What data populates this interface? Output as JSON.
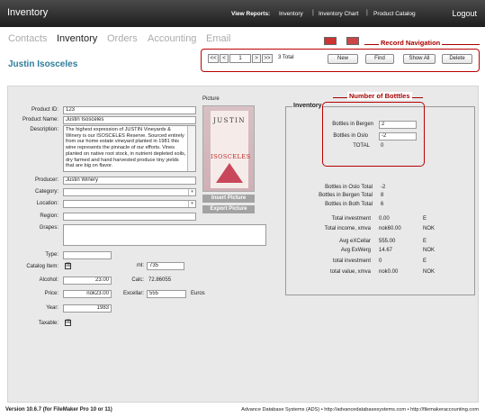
{
  "app": {
    "title": "Inventory",
    "logout": "Logout"
  },
  "reports": {
    "label": "View Reports:",
    "links": [
      "Inventory",
      "Inventory Chart",
      "Product Catalog"
    ]
  },
  "tabs": [
    "Contacts",
    "Inventory",
    "Orders",
    "Accounting",
    "Email"
  ],
  "annotations": {
    "record_navigation": "Record Navigation",
    "number_of_bottles": "Number of Botttles"
  },
  "nav": {
    "first": "<<",
    "prev": "<",
    "record": "1",
    "next": ">",
    "last": ">>",
    "total": "3  Total",
    "new": "New",
    "find": "Find",
    "show_all": "Show All",
    "delete": "Delete"
  },
  "record_name": "Justin Isosceles",
  "form": {
    "product_id_label": "Product ID:",
    "product_id": "123",
    "product_name_label": "Product Name:",
    "product_name": "Justin Isosceles",
    "description_label": "Description:",
    "description": "The highest expression of JUSTIN Vineyards & Winery is our ISOSCELES Reserve. Sourced entirely from our home estate vineyard planted in 1981 this wine represents the pinnacle of our efforts. Vines planted on native root stock, in nutrient depleted soils, dry farmed and hand harvested produce tiny yields that are big on flavor.",
    "producer_label": "Producer:",
    "producer": "Justin Winery",
    "category_label": "Category:",
    "location_label": "Location:",
    "region_label": "Region:",
    "grapes_label": "Grapes:",
    "type_label": "Type:",
    "catalog_item_label": "Catalog Item:",
    "alcohol_label": "Alcohol:",
    "alcohol": "23.00",
    "price_label": "Price:",
    "price": "nok23.00",
    "year_label": "Year:",
    "year": "1983",
    "taxable_label": "Taxable:",
    "ml_label": "ml:",
    "ml": "735",
    "calc_label": "Calc:",
    "calc": "72.86055",
    "excellar_label": "Excellar:",
    "excellar": "555",
    "euros": "Euros"
  },
  "picture": {
    "label": "Picture",
    "insert": "Insert Picture",
    "export": "Export Picture",
    "label_top": "JUSTIN",
    "label_mid": "ISOSCELES"
  },
  "inventory": {
    "title": "Inventory",
    "bergen_label": "Bottles in Bergen",
    "bergen": "2",
    "oslo_label": "Bottles in Oslo",
    "oslo": "-2",
    "total_label": "TOTAL",
    "total": "0",
    "rows": [
      {
        "label": "Bottles in Oslo Total",
        "value": "-2",
        "unit": ""
      },
      {
        "label": "Bottles in Bergen Total",
        "value": "8",
        "unit": ""
      },
      {
        "label": "Bottles in Both Total",
        "value": "6",
        "unit": ""
      },
      {
        "label": "Total investment",
        "value": "0.00",
        "unit": "E"
      },
      {
        "label": "Total income, xmva",
        "value": "nok60.00",
        "unit": "NOK"
      },
      {
        "label": "Avg eXCellar",
        "value": "555.00",
        "unit": "E"
      },
      {
        "label": "Avg ExWerg",
        "value": "14.67",
        "unit": "NOK"
      },
      {
        "label": "total investment",
        "value": "0",
        "unit": "E"
      },
      {
        "label": "total value, xmva",
        "value": "nok0.00",
        "unit": "NOK"
      }
    ]
  },
  "footer": {
    "version": "Version 10.6.7 (for FileMaker Pro 10 or 11)",
    "credits": "Advance Database Systems (ADS) • http://advancedatabasesystems.com • http://filemakeraccounting.com"
  },
  "colors": {
    "accent": "#2e7d9a",
    "annotation": "#b00000",
    "topbar": "#2a2a2a"
  }
}
